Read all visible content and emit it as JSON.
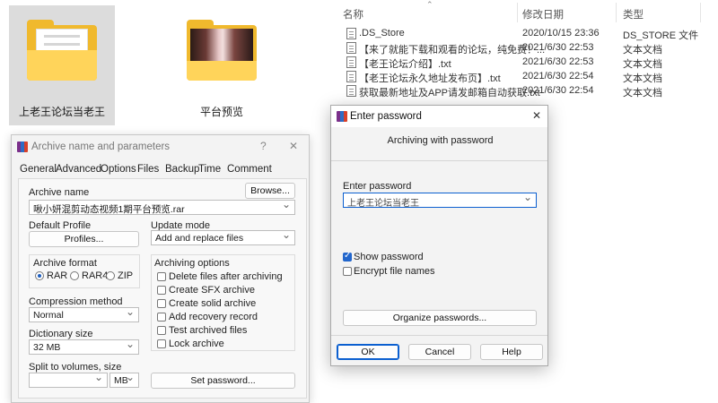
{
  "folders": [
    {
      "label": "上老王论坛当老王",
      "type": "documents"
    },
    {
      "label": "平台预览",
      "type": "photo"
    }
  ],
  "file_list": {
    "headers": {
      "name": "名称",
      "modified": "修改日期",
      "type": "类型"
    },
    "rows": [
      {
        "name": ".DS_Store",
        "modified": "2020/10/15 23:36",
        "type": "DS_STORE 文件"
      },
      {
        "name": "【来了就能下载和观看的论坛，纯免费！...",
        "modified": "2021/6/30 22:53",
        "type": "文本文档"
      },
      {
        "name": "【老王论坛介绍】.txt",
        "modified": "2021/6/30 22:53",
        "type": "文本文档"
      },
      {
        "name": "【老王论坛永久地址发布页】.txt",
        "modified": "2021/6/30 22:54",
        "type": "文本文档"
      },
      {
        "name": "获取最新地址及APP请发邮箱自动获取.txt",
        "modified": "2021/6/30 22:54",
        "type": "文本文档"
      }
    ]
  },
  "archive_dialog": {
    "title": "Archive name and parameters",
    "help": "?",
    "close": "✕",
    "tabs": [
      "General",
      "Advanced",
      "Options",
      "Files",
      "Backup",
      "Time",
      "Comment"
    ],
    "archive_name_label": "Archive name",
    "browse_label": "Browse...",
    "archive_name_value": "啾小妍混剪动态视频1期平台预览.rar",
    "default_profile_label": "Default Profile",
    "profiles_label": "Profiles...",
    "update_mode_label": "Update mode",
    "update_mode_value": "Add and replace files",
    "archive_format_label": "Archive format",
    "formats": [
      "RAR",
      "RAR4",
      "ZIP"
    ],
    "archiving_options_label": "Archiving options",
    "options": [
      "Delete files after archiving",
      "Create SFX archive",
      "Create solid archive",
      "Add recovery record",
      "Test archived files",
      "Lock archive"
    ],
    "compression_label": "Compression method",
    "compression_value": "Normal",
    "dictionary_label": "Dictionary size",
    "dictionary_value": "32 MB",
    "split_label": "Split to volumes, size",
    "split_unit": "MB",
    "set_password_label": "Set password..."
  },
  "password_dialog": {
    "title": "Enter password",
    "close": "✕",
    "subtitle": "Archiving with password",
    "enter_password_label": "Enter password",
    "password_value": "上老王论坛当老王",
    "show_password_label": "Show password",
    "show_password_checked": true,
    "encrypt_names_label": "Encrypt file names",
    "encrypt_names_checked": false,
    "organize_label": "Organize passwords...",
    "ok_label": "OK",
    "cancel_label": "Cancel",
    "help_label": "Help",
    "accent": "#0b5fd0"
  }
}
